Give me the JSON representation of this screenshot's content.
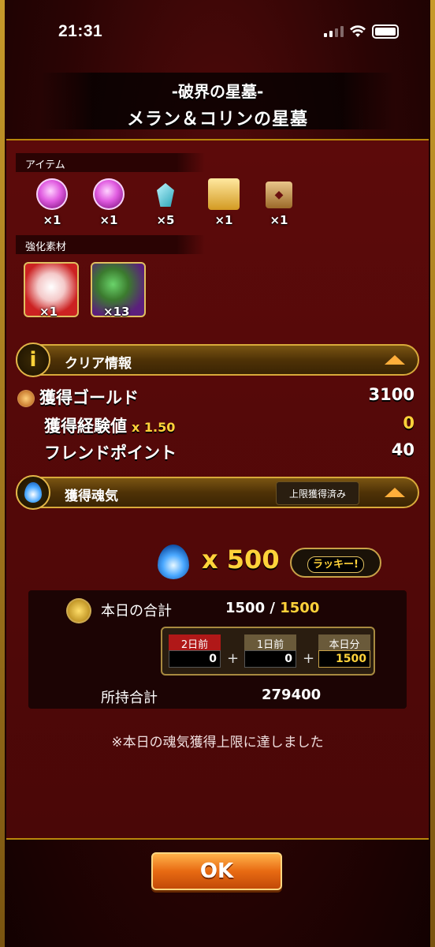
{
  "status": {
    "time": "21:31"
  },
  "title": {
    "line1": "-破界の星墓-",
    "line2": "メラン＆コリンの星墓"
  },
  "items_section": {
    "label": "アイテム",
    "items": [
      {
        "icon": "purple-orb-icon",
        "qty": "×1"
      },
      {
        "icon": "purple-orb-icon",
        "qty": "×1"
      },
      {
        "icon": "crystal-icon",
        "qty": "×5"
      },
      {
        "icon": "scroll-icon",
        "qty": "×1"
      },
      {
        "icon": "dice-icon",
        "qty": "×1"
      }
    ]
  },
  "materials_section": {
    "label": "強化素材",
    "items": [
      {
        "icon": "monster-material-icon",
        "qty": "×1"
      },
      {
        "icon": "monster-material-icon",
        "qty": "×13"
      }
    ]
  },
  "clear_info": {
    "title": "クリア情報",
    "gold_label": "獲得ゴールド",
    "gold_value": "3100",
    "exp_label": "獲得経験値",
    "exp_multiplier": "x 1.50",
    "exp_value": "0",
    "friend_label": "フレンドポイント",
    "friend_value": "40"
  },
  "soul": {
    "title": "獲得魂気",
    "badge": "上限獲得済み",
    "amount": "x 500",
    "lucky": "ラッキー!",
    "today_label": "本日の合計",
    "today_value": "1500",
    "today_sep": "/",
    "today_max": "1500",
    "days": [
      {
        "label": "2日前",
        "value": "0"
      },
      {
        "label": "1日前",
        "value": "0"
      },
      {
        "label": "本日分",
        "value": "1500"
      }
    ],
    "plus": "+",
    "owned_label": "所持合計",
    "owned_value": "279400",
    "note": "※本日の魂気獲得上限に達しました"
  },
  "ok_label": "OK",
  "colors": {
    "accent": "#ffd23a",
    "panel": "#5c0a0a",
    "ok": "#e86a12"
  }
}
